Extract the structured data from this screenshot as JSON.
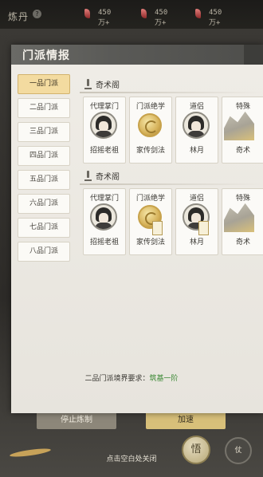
{
  "topbar": {
    "title": "炼丹",
    "currencies": [
      "450万+",
      "450万+",
      "450万+"
    ]
  },
  "modal": {
    "title": "门派情报",
    "tabs": [
      "一品门派",
      "二品门派",
      "三品门派",
      "四品门派",
      "五品门派",
      "六品门派",
      "七品门派",
      "八品门派"
    ],
    "active_tab": "一品门派",
    "sections": [
      {
        "title": "奇术阁",
        "cards": [
          {
            "role": "代理掌门",
            "name": "招摇老祖",
            "type": "portrait"
          },
          {
            "role": "门派绝学",
            "name": "家传剑法",
            "type": "coin"
          },
          {
            "role": "道侣",
            "name": "林月",
            "type": "portrait"
          },
          {
            "role": "特殊",
            "name": "奇术",
            "type": "scroll"
          }
        ]
      },
      {
        "title": "奇术阁",
        "cards": [
          {
            "role": "代理掌门",
            "name": "招摇老祖",
            "type": "portrait"
          },
          {
            "role": "门派绝学",
            "name": "家传剑法",
            "type": "coin"
          },
          {
            "role": "道侣",
            "name": "林月",
            "type": "portrait"
          },
          {
            "role": "特殊",
            "name": "奇术",
            "type": "scroll"
          }
        ]
      }
    ],
    "requirement_label": "二品门派境界要求：",
    "requirement_value": "筑基一阶"
  },
  "buttons": {
    "stop": "停止炼制",
    "speed": "加速",
    "seal": "悟",
    "round": "仗"
  },
  "hint": "点击空白处关闭"
}
